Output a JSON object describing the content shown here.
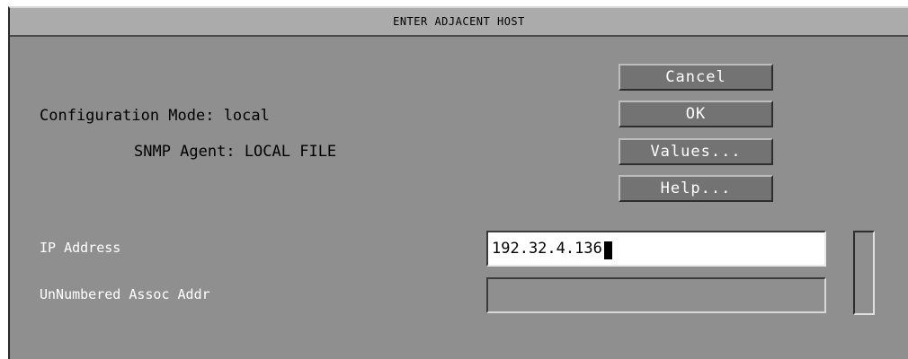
{
  "window": {
    "title": "ENTER ADJACENT HOST"
  },
  "info": {
    "config_mode": "Configuration Mode: local",
    "snmp_agent": "SNMP Agent: LOCAL FILE"
  },
  "buttons": {
    "cancel": "Cancel",
    "ok": "OK",
    "values": "Values...",
    "help": "Help..."
  },
  "fields": {
    "ip_address": {
      "label": "IP Address",
      "value": "192.32.4.136"
    },
    "unnumbered": {
      "label": "UnNumbered Assoc Addr",
      "value": ""
    }
  },
  "colors": {
    "window_bg": "#8f8f8f",
    "titlebar_bg": "#ababab",
    "button_bg": "#737373"
  }
}
